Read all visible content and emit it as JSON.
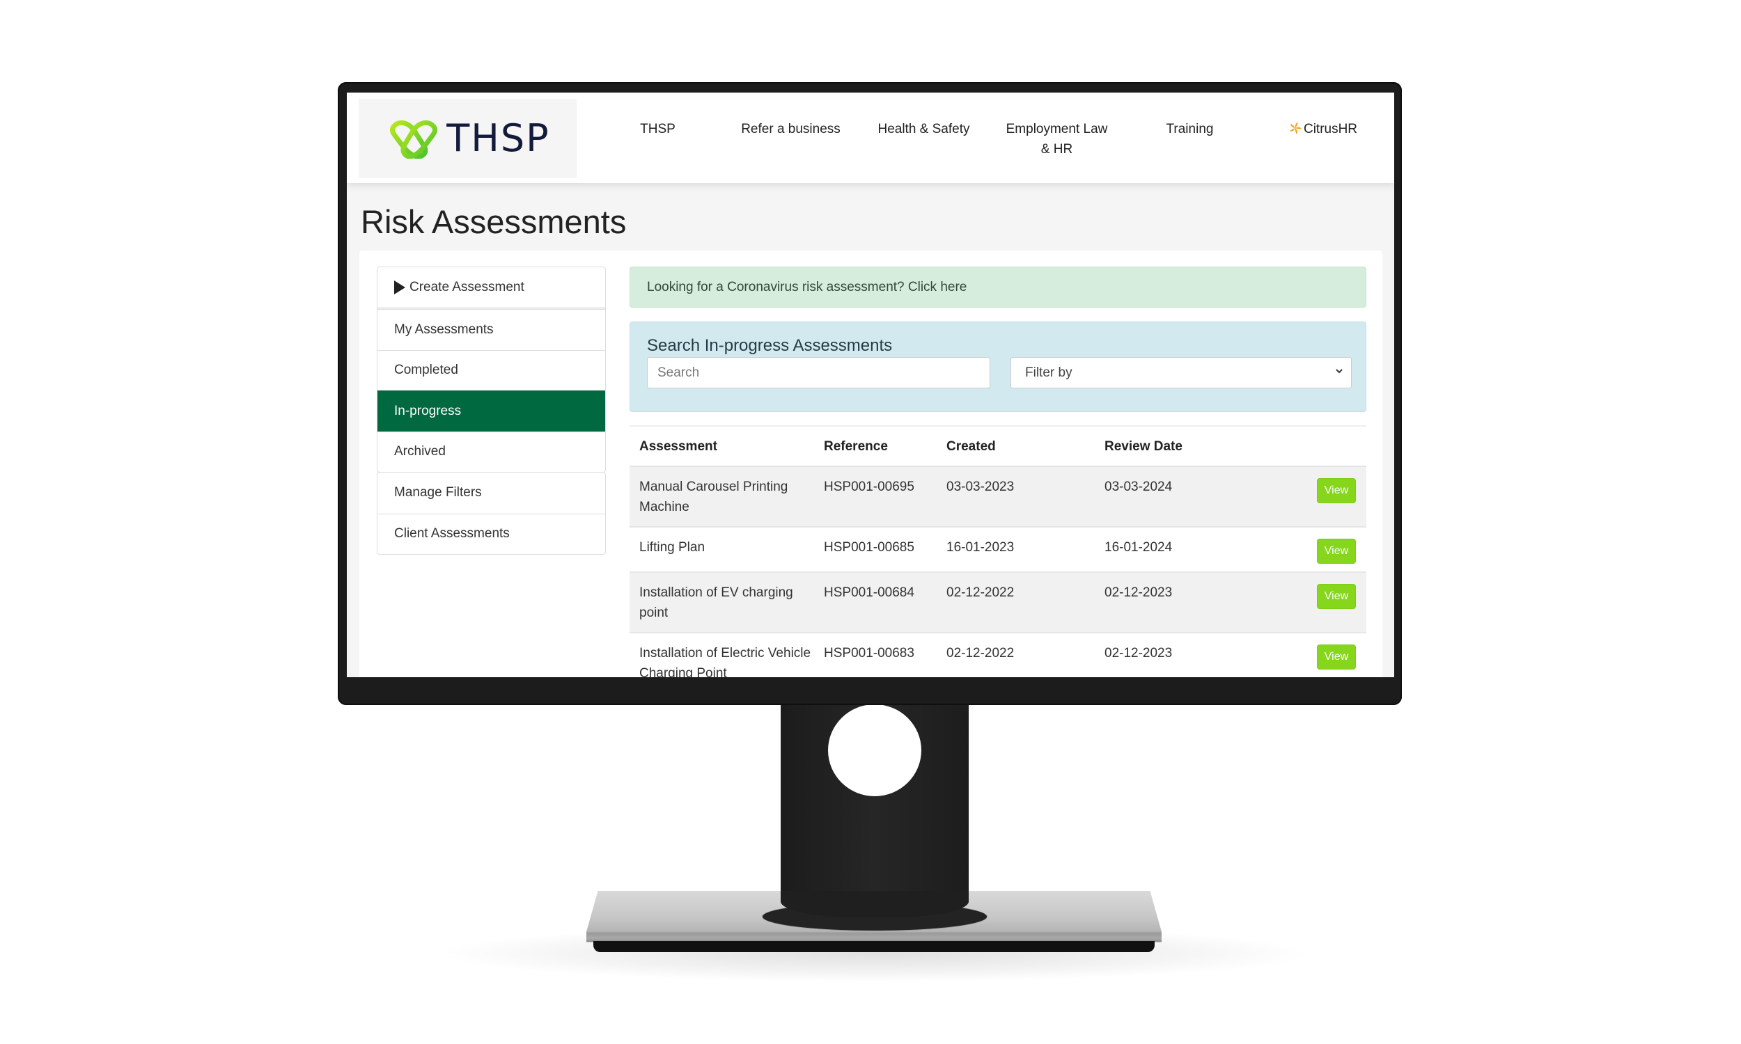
{
  "header": {
    "logo_text": "THSP",
    "nav": [
      {
        "label": "THSP"
      },
      {
        "label": "Refer a business"
      },
      {
        "label": "Health & Safety"
      },
      {
        "label": "Employment Law & HR"
      },
      {
        "label": "Training"
      },
      {
        "label": "CitrusHR",
        "icon": "citrus-flower-icon"
      }
    ]
  },
  "page": {
    "title": "Risk Assessments"
  },
  "sidebar": {
    "primary": [
      {
        "label": "Create Assessment",
        "icon": "play-icon"
      },
      {
        "label": "My Assessments"
      },
      {
        "label": "Completed"
      },
      {
        "label": "In-progress",
        "active": true
      },
      {
        "label": "Archived"
      }
    ],
    "secondary": [
      {
        "label": "Manage Filters"
      },
      {
        "label": "Client Assessments"
      }
    ]
  },
  "alert": {
    "text": "Looking for a Coronavirus risk assessment? Click here"
  },
  "search": {
    "heading": "Search In-progress Assessments",
    "input_placeholder": "Search",
    "input_value": "",
    "filter_selected": "Filter by"
  },
  "table": {
    "columns": [
      "Assessment",
      "Reference",
      "Created",
      "Review Date",
      ""
    ],
    "rows": [
      {
        "assessment": "Manual Carousel Printing Machine",
        "reference": "HSP001-00695",
        "created": "03-03-2023",
        "review_date": "03-03-2024",
        "action": "View"
      },
      {
        "assessment": "Lifting Plan",
        "reference": "HSP001-00685",
        "created": "16-01-2023",
        "review_date": "16-01-2024",
        "action": "View"
      },
      {
        "assessment": "Installation of EV charging point",
        "reference": "HSP001-00684",
        "created": "02-12-2022",
        "review_date": "02-12-2023",
        "action": "View"
      },
      {
        "assessment": "Installation of Electric Vehicle Charging Point",
        "reference": "HSP001-00683",
        "created": "02-12-2022",
        "review_date": "02-12-2023",
        "action": "View"
      }
    ]
  },
  "colors": {
    "brand_green": "#006940",
    "logo_green": "#7ed321",
    "view_button": "#86d61c",
    "alert_success_bg": "#d6ecdc",
    "info_panel_bg": "#d2e9ef",
    "logo_navy": "#141a3a",
    "citrus_orange": "#f5a623"
  }
}
